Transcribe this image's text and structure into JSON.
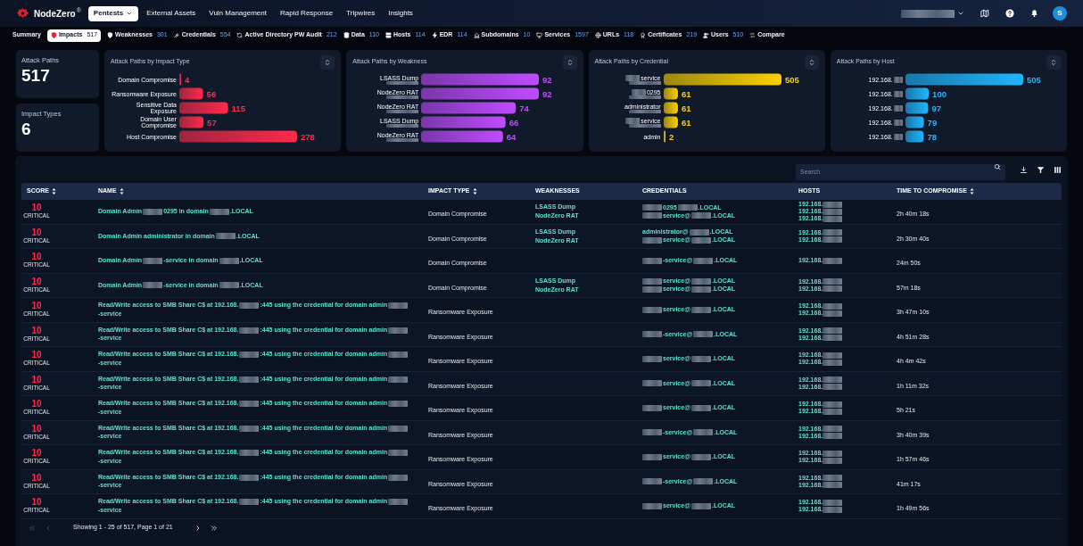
{
  "brand": {
    "name": "NodeZero",
    "mark": "®"
  },
  "main_nav": [
    {
      "label": "Pentests",
      "selected": true,
      "dropdown": true
    },
    {
      "label": "External Assets",
      "selected": false,
      "dropdown": false
    },
    {
      "label": "Vuln Management",
      "selected": false,
      "dropdown": false
    },
    {
      "label": "Rapid Response",
      "selected": false,
      "dropdown": false
    },
    {
      "label": "Tripwires",
      "selected": false,
      "dropdown": false
    },
    {
      "label": "Insights",
      "selected": false,
      "dropdown": false
    }
  ],
  "user": {
    "avatar": "S"
  },
  "sub_nav": [
    {
      "label": "Summary",
      "selected": false
    },
    {
      "label": "Impacts",
      "count": "517",
      "selected": true
    },
    {
      "label": "Weaknesses",
      "count": "301",
      "selected": false
    },
    {
      "label": "Credentials",
      "count": "554",
      "selected": false
    },
    {
      "label": "Active Directory PW Audit",
      "count": "212",
      "selected": false
    },
    {
      "label": "Data",
      "count": "110",
      "selected": false
    },
    {
      "label": "Hosts",
      "count": "114",
      "selected": false
    },
    {
      "label": "EDR",
      "count": "114",
      "selected": false
    },
    {
      "label": "Subdomains",
      "count": "10",
      "selected": false
    },
    {
      "label": "Services",
      "count": "1597",
      "selected": false
    },
    {
      "label": "URLs",
      "count": "118",
      "selected": false
    },
    {
      "label": "Certificates",
      "count": "219",
      "selected": false
    },
    {
      "label": "Users",
      "count": "510",
      "selected": false
    },
    {
      "label": "Compare",
      "selected": false
    }
  ],
  "stats": [
    {
      "label": "Attack Paths",
      "value": "517"
    },
    {
      "label": "Impact Types",
      "value": "6"
    }
  ],
  "panels": [
    {
      "title": "Attack Paths by Impact Type",
      "labels": [
        {
          "kind": "plain"
        },
        {
          "kind": "plain"
        },
        {
          "kind": "plain"
        },
        {
          "kind": "plain"
        },
        {
          "kind": "plain"
        }
      ],
      "chart_data": {
        "type": "bar",
        "orientation": "horizontal",
        "categories": [
          "Domain Compromise",
          "Ransomware Exposure",
          "Sensitive Data Exposure",
          "Domain User Compromise",
          "Host Compromise"
        ],
        "series": [
          {
            "color": "#ff2a4d",
            "values": [
              4,
              56,
              115,
              57,
              278
            ]
          }
        ],
        "data_labels": true
      }
    },
    {
      "title": "Attack Paths by Weakness",
      "labels": [
        {
          "kind": "stacked"
        },
        {
          "kind": "stacked"
        },
        {
          "kind": "stacked"
        },
        {
          "kind": "stacked"
        },
        {
          "kind": "stacked"
        }
      ],
      "chart_data": {
        "type": "bar",
        "orientation": "horizontal",
        "categories": [
          "LSASS Dump",
          "NodeZero RAT",
          "NodeZero RAT",
          "LSASS Dump",
          "NodeZero RAT"
        ],
        "series": [
          {
            "color": "#c04bff",
            "values": [
              92,
              92,
              74,
              66,
              64
            ]
          }
        ],
        "data_labels": true
      }
    },
    {
      "title": "Attack Paths by Credential",
      "labels": [
        {
          "kind": "prefixed"
        },
        {
          "kind": "prefixed"
        },
        {
          "kind": "stacked"
        },
        {
          "kind": "prefixed"
        },
        {
          "kind": "plain"
        }
      ],
      "chart_data": {
        "type": "bar",
        "orientation": "horizontal",
        "categories": [
          "service",
          "0295",
          "administrator",
          "service",
          "admin"
        ],
        "series": [
          {
            "color": "#fcd000",
            "values": [
              505,
              61,
              61,
              61,
              2
            ]
          }
        ],
        "data_labels": true
      }
    },
    {
      "title": "Attack Paths by Host",
      "labels": [
        {
          "kind": "suffixed"
        },
        {
          "kind": "suffixed"
        },
        {
          "kind": "suffixed"
        },
        {
          "kind": "suffixed"
        },
        {
          "kind": "suffixed"
        }
      ],
      "chart_data": {
        "type": "bar",
        "orientation": "horizontal",
        "categories": [
          "192.168.",
          "192.168.",
          "192.168.",
          "192.168.",
          "192.168."
        ],
        "series": [
          {
            "color": "#1fb6ff",
            "values": [
              505,
              100,
              97,
              79,
              78
            ]
          }
        ],
        "data_labels": true
      }
    }
  ],
  "search": {
    "placeholder": "Search"
  },
  "table": {
    "columns": [
      {
        "label": "SCORE",
        "sortable": true
      },
      {
        "label": "NAME",
        "sortable": true
      },
      {
        "label": "IMPACT TYPE",
        "sortable": true
      },
      {
        "label": "WEAKNESSES",
        "sortable": false
      },
      {
        "label": "CREDENTIALS",
        "sortable": false
      },
      {
        "label": "HOSTS",
        "sortable": false
      },
      {
        "label": "TIME TO COMPROMISE",
        "sortable": true
      }
    ],
    "rows": [
      {
        "score": "10",
        "severity": "CRITICAL",
        "name": [
          "Domain Admin",
          {
            "kind": "redacted"
          },
          "0295 in domain",
          {
            "kind": "redacted"
          },
          ".LOCAL"
        ],
        "impact_type": "Domain Compromise",
        "weaknesses": [
          "LSASS Dump",
          "NodeZero RAT"
        ],
        "credentials": [
          [
            {
              "kind": "redacted"
            },
            "0295",
            {
              "kind": "redacted"
            },
            ".LOCAL"
          ],
          [
            {
              "kind": "redacted"
            },
            "service@",
            {
              "kind": "redacted"
            },
            ".LOCAL"
          ]
        ],
        "hosts": [
          [
            "192.168.",
            {
              "kind": "redacted"
            }
          ],
          [
            "192.168.",
            {
              "kind": "redacted"
            }
          ],
          [
            "192.168.",
            {
              "kind": "redacted"
            }
          ]
        ],
        "time": "2h 40m 18s"
      },
      {
        "score": "10",
        "severity": "CRITICAL",
        "name": [
          "Domain Admin administrator in domain",
          {
            "kind": "redacted"
          },
          ".LOCAL"
        ],
        "impact_type": "Domain Compromise",
        "weaknesses": [
          "LSASS Dump",
          "NodeZero RAT"
        ],
        "credentials": [
          [
            "administrator@",
            {
              "kind": "redacted"
            },
            ".LOCAL"
          ],
          [
            {
              "kind": "redacted"
            },
            "service@",
            {
              "kind": "redacted"
            },
            ".LOCAL"
          ]
        ],
        "hosts": [
          [
            "192.168.",
            {
              "kind": "redacted"
            }
          ],
          [
            "192.168.",
            {
              "kind": "redacted"
            }
          ]
        ],
        "time": "2h 30m 40s"
      },
      {
        "score": "10",
        "severity": "CRITICAL",
        "name": [
          "Domain Admin",
          {
            "kind": "redacted"
          },
          "-service in domain",
          {
            "kind": "redacted"
          },
          ".LOCAL"
        ],
        "impact_type": "Domain Compromise",
        "weaknesses": [],
        "credentials": [
          [
            {
              "kind": "redacted"
            },
            "-service@",
            {
              "kind": "redacted"
            },
            ".LOCAL"
          ]
        ],
        "hosts": [
          [
            "192.168.",
            {
              "kind": "redacted"
            }
          ]
        ],
        "time": "24m 50s"
      },
      {
        "score": "10",
        "severity": "CRITICAL",
        "name": [
          "Domain Admin",
          {
            "kind": "redacted"
          },
          "-service in domain",
          {
            "kind": "redacted"
          },
          ".LOCAL"
        ],
        "impact_type": "Domain Compromise",
        "weaknesses": [
          "LSASS Dump",
          "NodeZero RAT"
        ],
        "credentials": [
          [
            {
              "kind": "redacted"
            },
            "service@",
            {
              "kind": "redacted"
            },
            ".LOCAL"
          ],
          [
            {
              "kind": "redacted"
            },
            "service@",
            {
              "kind": "redacted"
            },
            ".LOCAL"
          ]
        ],
        "hosts": [
          [
            "192.168.",
            {
              "kind": "redacted"
            }
          ],
          [
            "192.168.",
            {
              "kind": "redacted"
            }
          ]
        ],
        "time": "57m 18s"
      },
      {
        "score": "10",
        "severity": "CRITICAL",
        "name": [
          "Read/Write access to SMB Share C$ at 192.168.",
          {
            "kind": "redacted"
          },
          ":445 using the credential for domain admin",
          {
            "kind": "redacted"
          },
          "-service"
        ],
        "impact_type": "Ransomware Exposure",
        "weaknesses": [],
        "credentials": [
          [
            {
              "kind": "redacted"
            },
            "service@",
            {
              "kind": "redacted"
            },
            ".LOCAL"
          ]
        ],
        "hosts": [
          [
            "192.168.",
            {
              "kind": "redacted"
            }
          ],
          [
            "192.168.",
            {
              "kind": "redacted"
            }
          ]
        ],
        "time": "3h 47m 10s"
      },
      {
        "score": "10",
        "severity": "CRITICAL",
        "name": [
          "Read/Write access to SMB Share C$ at 192.168.",
          {
            "kind": "redacted"
          },
          ":445 using the credential for domain admin",
          {
            "kind": "redacted"
          },
          "-service"
        ],
        "impact_type": "Ransomware Exposure",
        "weaknesses": [],
        "credentials": [
          [
            {
              "kind": "redacted"
            },
            "-service@",
            {
              "kind": "redacted"
            },
            ".LOCAL"
          ]
        ],
        "hosts": [
          [
            "192.168.",
            {
              "kind": "redacted"
            }
          ],
          [
            "192.168.",
            {
              "kind": "redacted"
            }
          ]
        ],
        "time": "4h 51m 28s"
      },
      {
        "score": "10",
        "severity": "CRITICAL",
        "name": [
          "Read/Write access to SMB Share C$ at 192.168.",
          {
            "kind": "redacted"
          },
          ":445 using the credential for domain admin",
          {
            "kind": "redacted"
          },
          "-service"
        ],
        "impact_type": "Ransomware Exposure",
        "weaknesses": [],
        "credentials": [
          [
            {
              "kind": "redacted"
            },
            "service@",
            {
              "kind": "redacted"
            },
            ".LOCAL"
          ]
        ],
        "hosts": [
          [
            "192.168.",
            {
              "kind": "redacted"
            }
          ],
          [
            "192.168.",
            {
              "kind": "redacted"
            }
          ]
        ],
        "time": "4h 4m 42s"
      },
      {
        "score": "10",
        "severity": "CRITICAL",
        "name": [
          "Read/Write access to SMB Share C$ at 192.168.",
          {
            "kind": "redacted"
          },
          ":445 using the credential for domain admin",
          {
            "kind": "redacted"
          },
          "-service"
        ],
        "impact_type": "Ransomware Exposure",
        "weaknesses": [],
        "credentials": [
          [
            {
              "kind": "redacted"
            },
            "service@",
            {
              "kind": "redacted"
            },
            ".LOCAL"
          ]
        ],
        "hosts": [
          [
            "192.168.",
            {
              "kind": "redacted"
            }
          ],
          [
            "192.168.",
            {
              "kind": "redacted"
            }
          ]
        ],
        "time": "1h 11m 32s"
      },
      {
        "score": "10",
        "severity": "CRITICAL",
        "name": [
          "Read/Write access to SMB Share C$ at 192.168.",
          {
            "kind": "redacted"
          },
          ":445 using the credential for domain admin",
          {
            "kind": "redacted"
          },
          "-service"
        ],
        "impact_type": "Ransomware Exposure",
        "weaknesses": [],
        "credentials": [
          [
            {
              "kind": "redacted"
            },
            "service@",
            {
              "kind": "redacted"
            },
            ".LOCAL"
          ]
        ],
        "hosts": [
          [
            "192.168.",
            {
              "kind": "redacted"
            }
          ],
          [
            "192.168.",
            {
              "kind": "redacted"
            }
          ]
        ],
        "time": "5h 21s"
      },
      {
        "score": "10",
        "severity": "CRITICAL",
        "name": [
          "Read/Write access to SMB Share C$ at 192.168.",
          {
            "kind": "redacted"
          },
          ":445 using the credential for domain admin",
          {
            "kind": "redacted"
          },
          "-service"
        ],
        "impact_type": "Ransomware Exposure",
        "weaknesses": [],
        "credentials": [
          [
            {
              "kind": "redacted"
            },
            "-service@",
            {
              "kind": "redacted"
            },
            ".LOCAL"
          ]
        ],
        "hosts": [
          [
            "192.168.",
            {
              "kind": "redacted"
            }
          ],
          [
            "192.168.",
            {
              "kind": "redacted"
            }
          ]
        ],
        "time": "3h 40m 39s"
      },
      {
        "score": "10",
        "severity": "CRITICAL",
        "name": [
          "Read/Write access to SMB Share C$ at 192.168.",
          {
            "kind": "redacted"
          },
          ":445 using the credential for domain admin",
          {
            "kind": "redacted"
          },
          "-service"
        ],
        "impact_type": "Ransomware Exposure",
        "weaknesses": [],
        "credentials": [
          [
            {
              "kind": "redacted"
            },
            "service@",
            {
              "kind": "redacted"
            },
            ".LOCAL"
          ]
        ],
        "hosts": [
          [
            "192.168.",
            {
              "kind": "redacted"
            }
          ],
          [
            "192.168.",
            {
              "kind": "redacted"
            }
          ]
        ],
        "time": "1h 57m 46s"
      },
      {
        "score": "10",
        "severity": "CRITICAL",
        "name": [
          "Read/Write access to SMB Share C$ at 192.168.",
          {
            "kind": "redacted"
          },
          ":445 using the credential for domain admin",
          {
            "kind": "redacted"
          },
          "-service"
        ],
        "impact_type": "Ransomware Exposure",
        "weaknesses": [],
        "credentials": [
          [
            {
              "kind": "redacted"
            },
            "-service@",
            {
              "kind": "redacted"
            },
            ".LOCAL"
          ]
        ],
        "hosts": [
          [
            "192.168.",
            {
              "kind": "redacted"
            }
          ],
          [
            "192.168.",
            {
              "kind": "redacted"
            }
          ]
        ],
        "time": "41m 17s"
      },
      {
        "score": "10",
        "severity": "CRITICAL",
        "name": [
          "Read/Write access to SMB Share C$ at 192.168.",
          {
            "kind": "redacted"
          },
          ":445 using the credential for domain admin",
          {
            "kind": "redacted"
          },
          "-service"
        ],
        "impact_type": "Ransomware Exposure",
        "weaknesses": [],
        "credentials": [
          [
            {
              "kind": "redacted"
            },
            "service@",
            {
              "kind": "redacted"
            },
            ".LOCAL"
          ]
        ],
        "hosts": [
          [
            "192.168.",
            {
              "kind": "redacted"
            }
          ],
          [
            "192.168.",
            {
              "kind": "redacted"
            }
          ]
        ],
        "time": "1h 49m 56s"
      }
    ]
  },
  "pagination": {
    "summary": "Showing 1 - 25 of 517, Page 1 of 21"
  }
}
